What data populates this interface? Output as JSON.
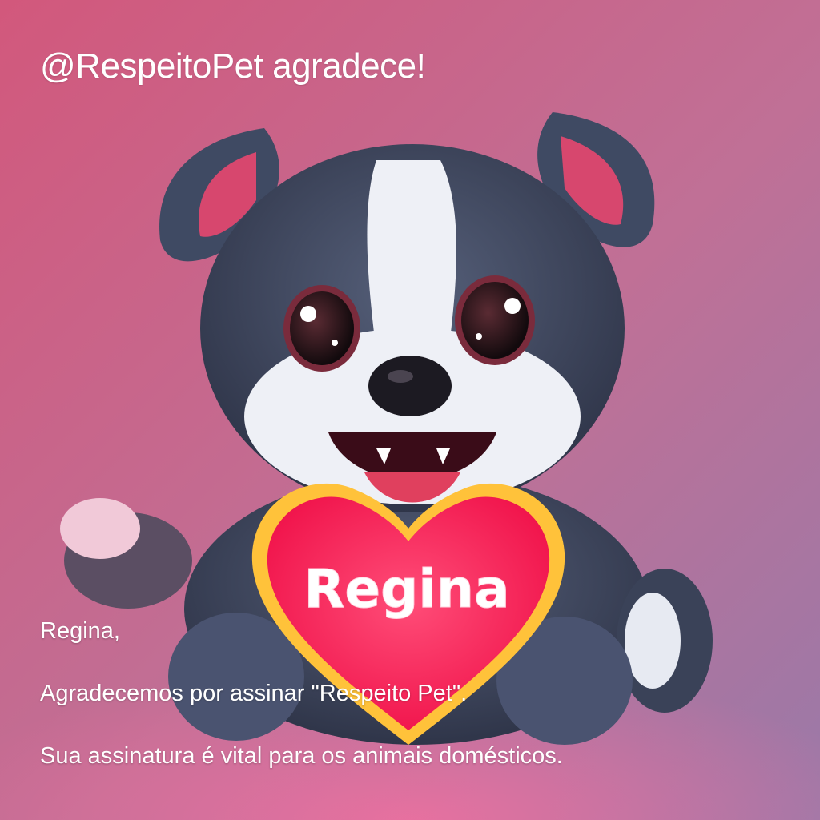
{
  "header": {
    "title": "@RespeitoPet agradece!"
  },
  "illustration": {
    "subject": "puppy-holding-heart",
    "heart_text": "Regina",
    "colors": {
      "background": "#c8607e",
      "heart": "#ff2a5a",
      "heart_outline": "#ffc23a",
      "fur": "#3f4a63"
    }
  },
  "message": {
    "greeting": "Regina,",
    "line1": "Agradecemos por assinar \"Respeito Pet\".",
    "line2": "Sua assinatura é vital para os animais domésticos."
  }
}
